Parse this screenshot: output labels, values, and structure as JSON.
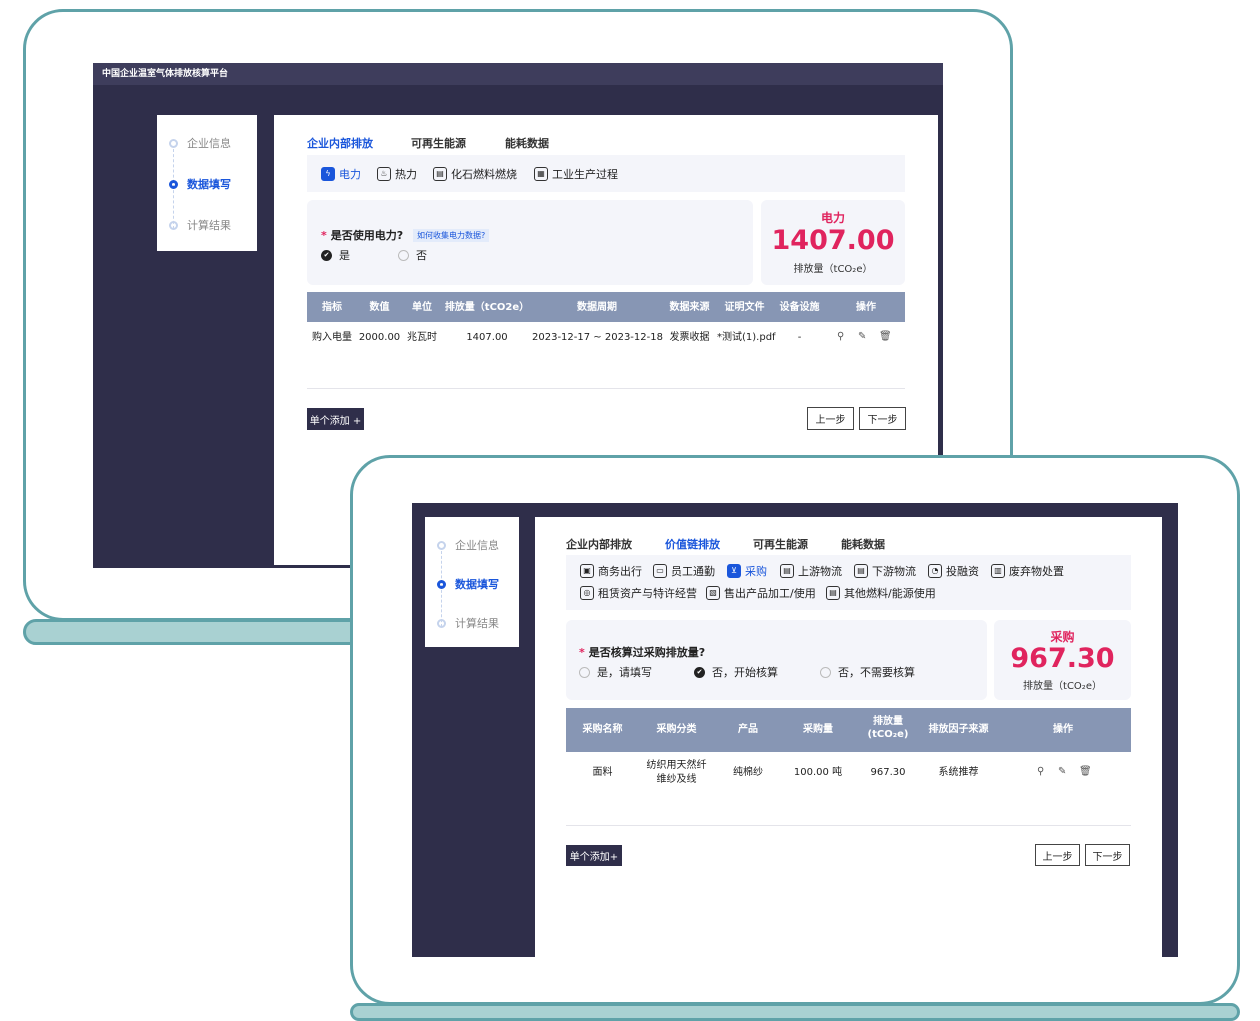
{
  "app_title": "中国企业温室气体排放核算平台",
  "steps": [
    "企业信息",
    "数据填写",
    "计算结果"
  ],
  "back": {
    "tabs": [
      "企业内部排放",
      "可再生能源",
      "能耗数据"
    ],
    "categories": [
      {
        "label": "电力",
        "icon": "lightning-icon"
      },
      {
        "label": "热力",
        "icon": "flame-icon"
      },
      {
        "label": "化石燃料燃烧",
        "icon": "fuel-icon"
      },
      {
        "label": "工业生产过程",
        "icon": "factory-icon"
      }
    ],
    "question": "是否使用电力?",
    "question_required": "*",
    "help_link": "如何收集电力数据?",
    "options": [
      "是",
      "否"
    ],
    "selected_option": "是",
    "emission": {
      "category": "电力",
      "value": "1407.00",
      "unit_label": "排放量（tCO₂e）"
    },
    "table": {
      "headers": [
        "指标",
        "数值",
        "单位",
        "排放量（tCO2e）",
        "数据周期",
        "数据来源",
        "证明文件",
        "设备设施",
        "操作"
      ],
      "rows": [
        [
          "购入电量",
          "2000.00",
          "兆瓦时",
          "1407.00",
          "2023-12-17 ~ 2023-12-18",
          "发票收据",
          "*测试(1).pdf",
          "-"
        ]
      ]
    },
    "add_button": "单个添加 +",
    "prev_button": "上一步",
    "next_button": "下一步"
  },
  "front": {
    "tabs": [
      "企业内部排放",
      "价值链排放",
      "可再生能源",
      "能耗数据"
    ],
    "categories": [
      {
        "label": "商务出行",
        "icon": "briefcase-icon"
      },
      {
        "label": "员工通勤",
        "icon": "bus-icon"
      },
      {
        "label": "采购",
        "icon": "cart-icon"
      },
      {
        "label": "上游物流",
        "icon": "truck-icon"
      },
      {
        "label": "下游物流",
        "icon": "truck-icon"
      },
      {
        "label": "投融资",
        "icon": "coins-icon"
      },
      {
        "label": "废弃物处置",
        "icon": "trash-bin-icon"
      },
      {
        "label": "租赁资产与特许经营",
        "icon": "lease-icon"
      },
      {
        "label": "售出产品加工/使用",
        "icon": "box-icon"
      },
      {
        "label": "其他燃料/能源使用",
        "icon": "fuel-icon"
      }
    ],
    "question": "是否核算过采购排放量?",
    "question_required": "*",
    "options": [
      "是，请填写",
      "否，开始核算",
      "否，不需要核算"
    ],
    "selected_option": "否，开始核算",
    "emission": {
      "category": "采购",
      "value": "967.30",
      "unit_label": "排放量（tCO₂e）"
    },
    "table": {
      "headers": [
        "采购名称",
        "采购分类",
        "产品",
        "采购量",
        "排放量\n(tCO₂e)",
        "排放因子来源",
        "操作"
      ],
      "rows": [
        [
          "面料",
          "纺织用天然纤\n维纱及线",
          "纯棉纱",
          "100.00 吨",
          "967.30",
          "系统推荐"
        ]
      ]
    },
    "add_button": "单个添加+",
    "prev_button": "上一步",
    "next_button": "下一步"
  },
  "colors": {
    "accent": "#1a56db",
    "emission": "#e0245e",
    "header": "#8796b4",
    "dark": "#2f2e4a",
    "frame": "#5fa2a8"
  }
}
